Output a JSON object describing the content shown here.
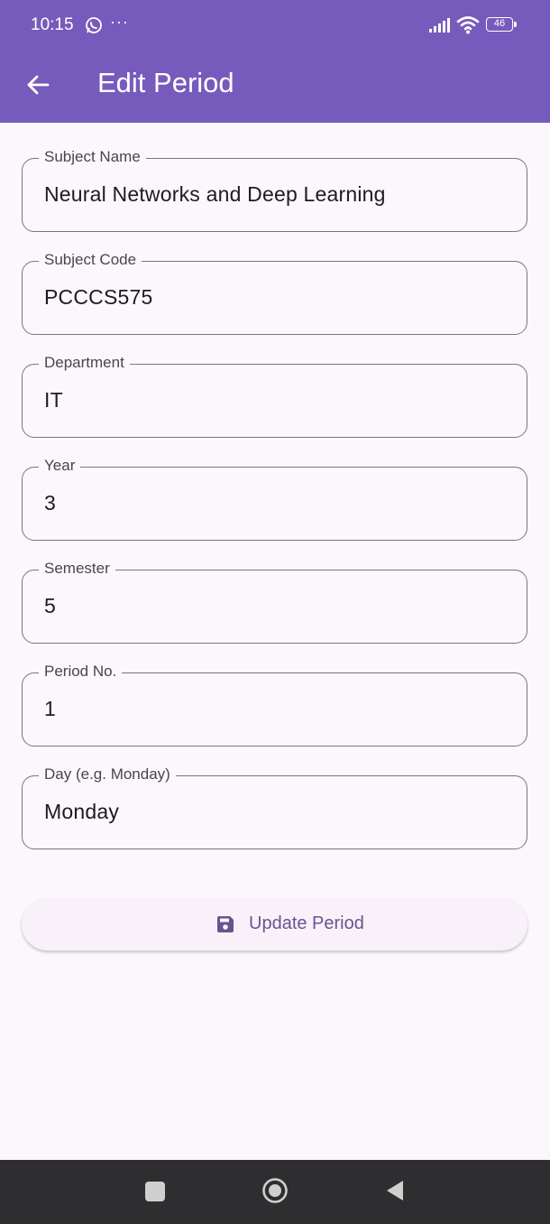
{
  "status": {
    "time": "10:15",
    "dots": "···",
    "battery": "46"
  },
  "appbar": {
    "title": "Edit Period"
  },
  "form": {
    "fields": [
      {
        "label": "Subject Name",
        "value": "Neural Networks and Deep Learning"
      },
      {
        "label": "Subject Code",
        "value": "PCCCS575"
      },
      {
        "label": "Department",
        "value": "IT"
      },
      {
        "label": "Year",
        "value": "3"
      },
      {
        "label": "Semester",
        "value": "5"
      },
      {
        "label": "Period No.",
        "value": "1"
      },
      {
        "label": "Day (e.g. Monday)",
        "value": "Monday"
      }
    ],
    "submit_label": "Update Period"
  },
  "colors": {
    "accent": "#775bbc",
    "button_text": "#65558f",
    "background": "#fcf6fd"
  },
  "icons": {
    "back": "arrow-back-icon",
    "save": "save-icon",
    "whatsapp": "whatsapp-icon",
    "signal": "signal-icon",
    "wifi": "wifi-icon",
    "battery": "battery-icon"
  }
}
